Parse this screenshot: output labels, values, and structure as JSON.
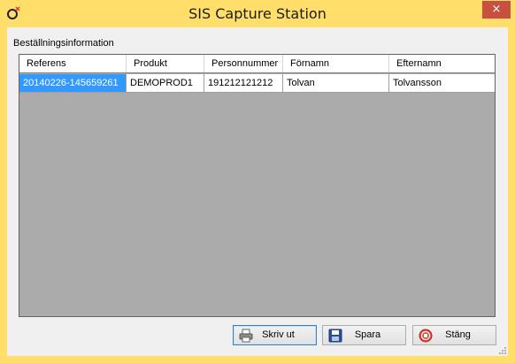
{
  "window": {
    "title": "SIS Capture Station",
    "close_label": "×"
  },
  "group": {
    "label": "Beställningsinformation"
  },
  "table": {
    "columns": [
      "Referens",
      "Produkt",
      "Personnummer",
      "Förnamn",
      "Efternamn"
    ],
    "rows": [
      [
        "20140226-145659261",
        "DEMOPROD1",
        "191212121212",
        "Tolvan",
        "Tolvansson"
      ]
    ]
  },
  "buttons": {
    "print": "Skriv ut",
    "save": "Spara",
    "close": "Stäng"
  },
  "colors": {
    "frame": "#ffdf69",
    "selection": "#3399ff",
    "grid_bg": "#ababab"
  }
}
